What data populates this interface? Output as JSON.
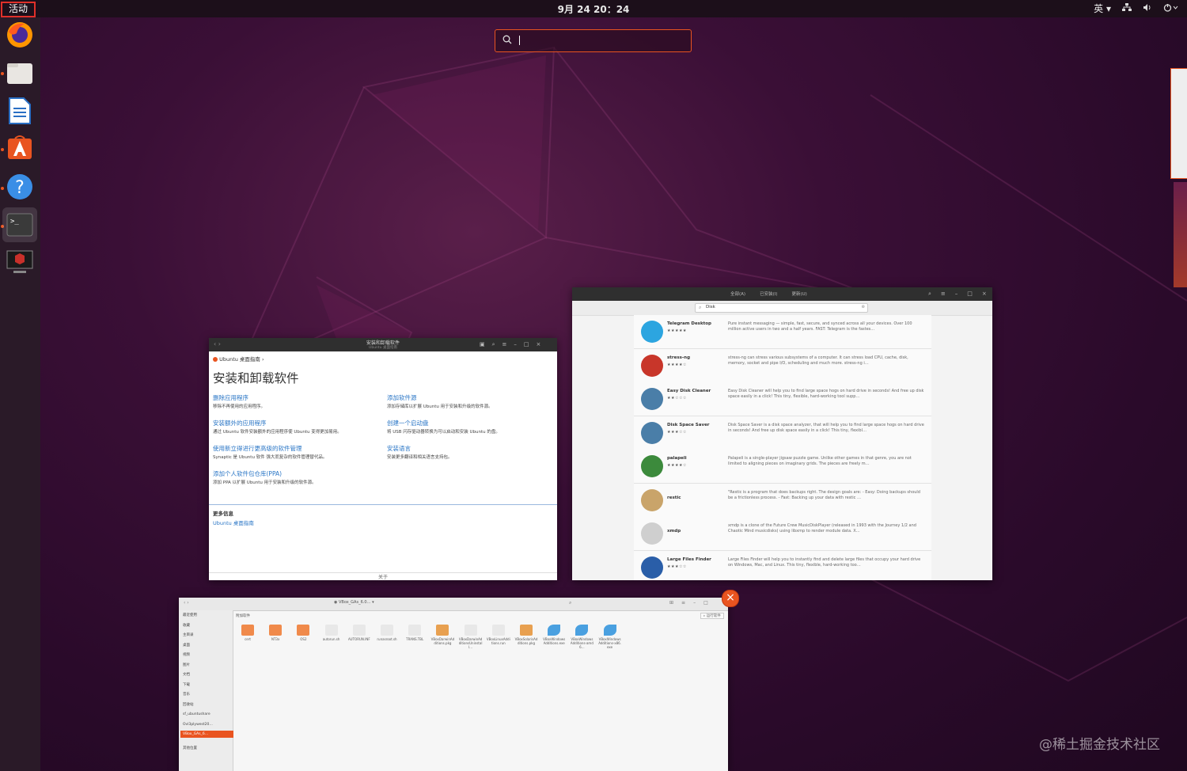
{
  "topbar": {
    "activities": "活动",
    "clock": "9月 24 20：24",
    "input_method": "英"
  },
  "dock": {
    "items": [
      "firefox-icon",
      "files-icon",
      "writer-icon",
      "software-icon",
      "help-icon",
      "terminal-icon",
      "remote-desktop-icon"
    ]
  },
  "search": {
    "value": ""
  },
  "help_window": {
    "title": "安装和卸载软件",
    "subtitle": "Ubuntu 桌面指南",
    "breadcrumb": "Ubuntu 桌面指南 ›",
    "heading": "安装和卸载软件",
    "left_links": [
      {
        "title": "删除应用程序",
        "desc": "移除不再使用的应用程序。"
      },
      {
        "title": "安装额外的应用程序",
        "desc": "通过 Ubuntu 软件安装额外的应用程序使 Ubuntu 变得更加易用。"
      },
      {
        "title": "使用新立得进行更高级的软件管理",
        "desc": "Synaptic 是 Ubuntu 软件 强大而复杂的软件管理替代品。"
      },
      {
        "title": "添加个人软件包仓库(PPA)",
        "desc": "添加 PPA 以扩展 Ubuntu 用于安装和升级的软件源。"
      }
    ],
    "right_links": [
      {
        "title": "添加软件源",
        "desc": "添加存储库以扩展 Ubuntu 用于安装和升级的软件源。"
      },
      {
        "title": "创建一个启动盘",
        "desc": "将 USB 闪存驱动器转换为可以启动和安装 Ubuntu 的盘。"
      },
      {
        "title": "安装语言",
        "desc": "安装更多翻译和相关语言支持包。"
      }
    ],
    "more_info_label": "更多信息",
    "more_info_link": "Ubuntu 桌面指南",
    "footer": "关于"
  },
  "software_window": {
    "tabs": [
      "全部(A)",
      "已安装(I)",
      "更新(U)"
    ],
    "search_value": "Disk",
    "apps": [
      {
        "name": "Telegram Desktop",
        "stars": "★★★★★",
        "desc": "Pure instant messaging — simple, fast, secure, and synced across all your devices. Over 100 million active users in two and a half years. FAST: Telegram is the fastes…",
        "color": "#2ca5e0"
      },
      {
        "name": "stress-ng",
        "stars": "★★★★☆",
        "desc": "stress-ng can stress various subsystems of a computer. It can stress load CPU, cache, disk, memory, socket and pipe I/O, scheduling and much more. stress-ng i…",
        "color": "#c8362a"
      },
      {
        "name": "Easy Disk Cleaner",
        "stars": "★★☆☆☆",
        "desc": "Easy Disk Cleaner will help you to find large space hogs on hard drive in seconds! And free up disk space easily in a click! This tiny, flexible, hard-working tool supp…",
        "color": "#4a7ea8"
      },
      {
        "name": "Disk Space Saver",
        "stars": "★★★☆☆",
        "desc": "Disk Space Saver is a disk space analyzer, that will help you to find large space hogs on hard drive in seconds! And free up disk space easily in a click! This tiny, flexibl…",
        "color": "#4a7ea8"
      },
      {
        "name": "palapeli",
        "stars": "★★★★☆",
        "desc": "Palapeli is a single-player jigsaw puzzle game. Unlike other games in that genre, you are not limited to aligning pieces on imaginary grids. The pieces are freely m…",
        "color": "#3c8a3c"
      },
      {
        "name": "restic",
        "stars": "",
        "desc": "\"Restic is a program that does backups right. The design goals are: - Easy: Doing backups should be a frictionless process. - Fast: Backing up your data with restic …",
        "color": "#c9a46a"
      },
      {
        "name": "xmdp",
        "stars": "",
        "desc": "xmdp is a clone of the Future Crew MusicDiskPlayer (released in 1993 with the Journey 1/2 and Chaotic Mind musicdisks) using libxmp to render module data. X…",
        "color": "#cfcfcf"
      },
      {
        "name": "Large Files Finder",
        "stars": "★★★☆☆",
        "desc": "Large Files Finder will help you to instantly find and delete large files that occupy your hard drive on Windows, Mac, and Linux. This tiny, flexible, hard-working too…",
        "color": "#2a5ea8"
      }
    ]
  },
  "files_window": {
    "path": "VBox_GAs_6.0…",
    "run_software": "运行软件",
    "folder_label": "附加软件",
    "sidebar": [
      "最近使用",
      "收藏",
      "主目录",
      "桌面",
      "视频",
      "图片",
      "文档",
      "下载",
      "音乐",
      "回收站",
      "sf_ubuntushare",
      "Ovl3plywest20…",
      "VBox_GAs_6…",
      "其他位置"
    ],
    "files": [
      {
        "name": "cert",
        "type": "folder"
      },
      {
        "name": "NT3x",
        "type": "folder"
      },
      {
        "name": "OS2",
        "type": "folder"
      },
      {
        "name": "autorun.sh",
        "type": "doc"
      },
      {
        "name": "AUTORUN.INF",
        "type": "doc"
      },
      {
        "name": "runasroot.sh",
        "type": "doc"
      },
      {
        "name": "TRANS.TBL",
        "type": "doc"
      },
      {
        "name": "VBoxDarwinAdditions.pkg",
        "type": "pkg"
      },
      {
        "name": "VBoxDarwinAdditionsUninstall…",
        "type": "doc"
      },
      {
        "name": "VBoxLinuxAdditions.run",
        "type": "doc"
      },
      {
        "name": "VBoxSolarisAdditions.pkg",
        "type": "pkg"
      },
      {
        "name": "VBoxWindowsAdditions.exe",
        "type": "exe"
      },
      {
        "name": "VBoxWindowsAdditions-amd6…",
        "type": "exe"
      },
      {
        "name": "VBoxWindowsAdditions-x86.exe",
        "type": "exe"
      }
    ]
  },
  "watermark": "@稀土掘金技术社区",
  "colors": {
    "accent": "#e95420",
    "link": "#2a76c6"
  }
}
